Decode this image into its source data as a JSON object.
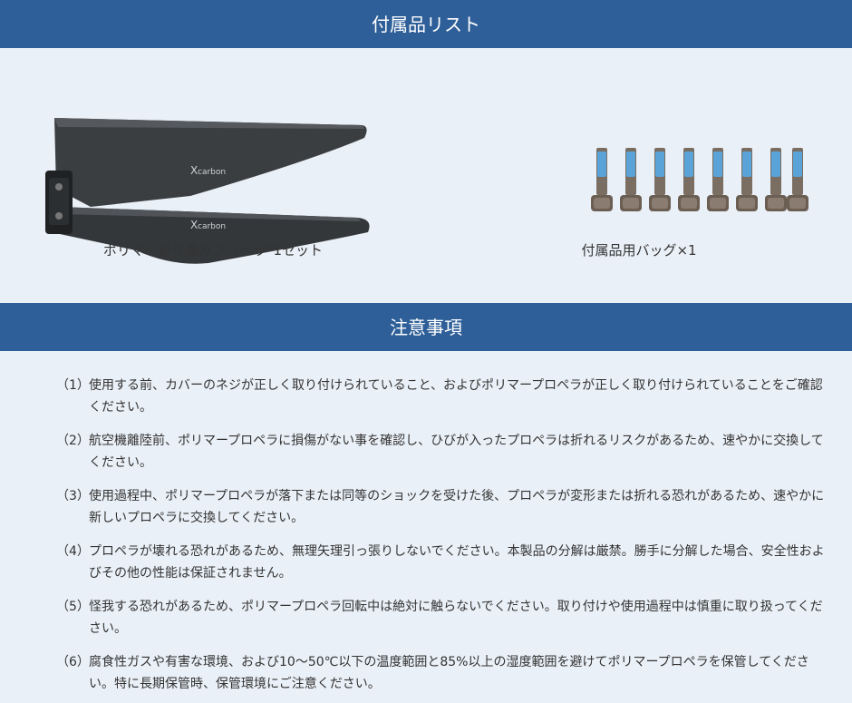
{
  "accessories_section": {
    "title": "付属品リスト",
    "items": [
      {
        "caption": "ポリマー折り畳みプロペラ*1セット",
        "image": "folding-propeller-pair",
        "logo_text": "carbon"
      },
      {
        "caption": "付属品用バッグ×1",
        "image": "hex-screws-set"
      }
    ]
  },
  "notes_section": {
    "title": "注意事項",
    "items": [
      {
        "num": "（1）",
        "text": "使用する前、カバーのネジが正しく取り付けられていること、およびポリマープロペラが正しく取り付けられていることをご確認ください。"
      },
      {
        "num": "（2）",
        "text": "航空機離陸前、ポリマープロペラに損傷がない事を確認し、ひびが入ったプロペラは折れるリスクがあるため、速やかに交換してください。"
      },
      {
        "num": "（3）",
        "text": "使用過程中、ポリマープロペラが落下または同等のショックを受けた後、プロペラが変形または折れる恐れがあるため、速やかに新しいプロペラに交換してください。"
      },
      {
        "num": "（4）",
        "text": "プロペラが壊れる恐れがあるため、無理矢理引っ張りしないでください。本製品の分解は厳禁。勝手に分解した場合、安全性およびその他の性能は保証されません。"
      },
      {
        "num": "（5）",
        "text": "怪我する恐れがあるため、ポリマープロペラ回転中は絶対に触らないでください。取り付けや使用過程中は慎重に取り扱ってください。"
      },
      {
        "num": "（6）",
        "text": "腐食性ガスや有害な環境、および10～50℃以下の温度範囲と85%以上の湿度範囲を避けてポリマープロペラを保管してください。特に長期保管時、保管環境にご注意ください。"
      }
    ]
  },
  "colors": {
    "header_bg": "#2f5f98",
    "header_text": "#ffffff",
    "page_bg": "#eaf0f7",
    "screw_thread": "#5aa3d8"
  }
}
